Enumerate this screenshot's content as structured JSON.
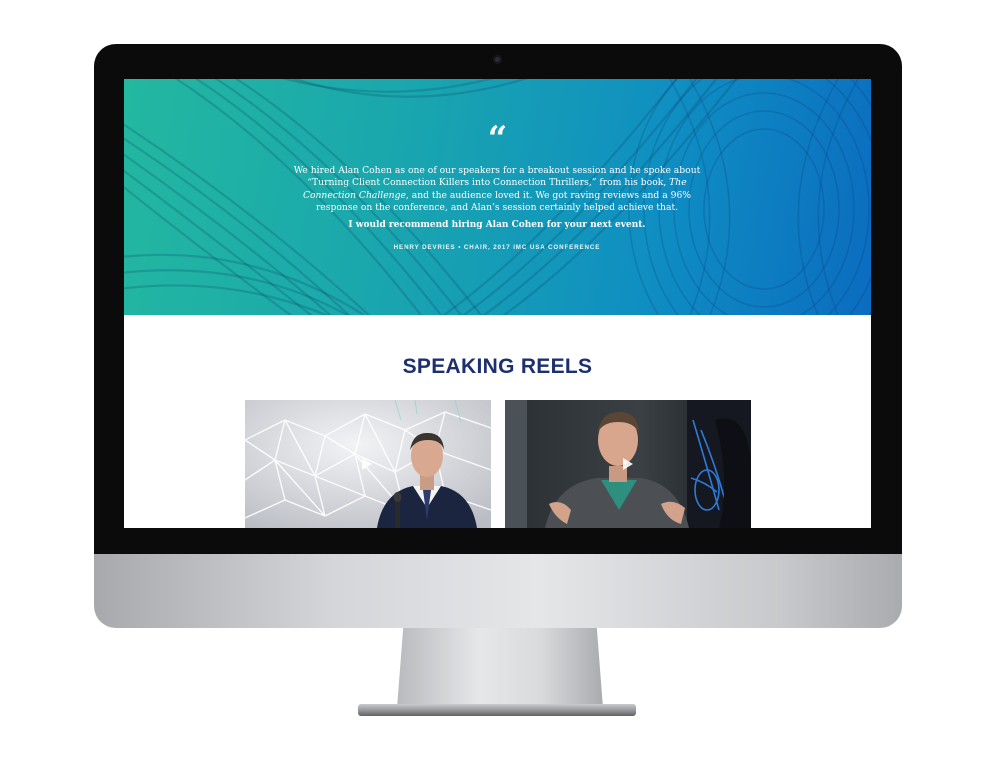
{
  "testimonial": {
    "quote_mark": "“",
    "body_before": "We hired Alan Cohen as one of our speakers for a breakout session and he spoke about “Turning Client Connection Killers into Connection Thrillers,” from his book, ",
    "book_title": "The Connection Challenge",
    "body_after": ", and the audience loved it. We got raving reviews and a 96% response on the conference, and Alan’s session certainly helped achieve that.",
    "recommendation": "I would recommend hiring Alan Cohen for your next event.",
    "attribution": "HENRY DEVRIES • CHAIR, 2017 IMC USA CONFERENCE"
  },
  "reels": {
    "title": "SPEAKING REELS",
    "videos": [
      {
        "label": "speaking-reel-1",
        "icon": "play-icon"
      },
      {
        "label": "speaking-reel-2",
        "icon": "play-icon"
      }
    ]
  },
  "colors": {
    "hero_start": "#23b8a0",
    "hero_end": "#0b6cc0",
    "title": "#1d2f6f"
  }
}
